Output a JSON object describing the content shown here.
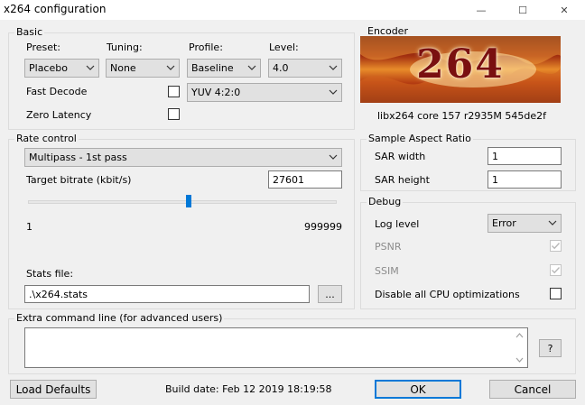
{
  "window": {
    "title": "x264 configuration",
    "minimize": "—",
    "maximize": "☐",
    "close": "✕"
  },
  "basic": {
    "group_label": "Basic",
    "preset_label": "Preset:",
    "preset_value": "Placebo",
    "tuning_label": "Tuning:",
    "tuning_value": "None",
    "profile_label": "Profile:",
    "profile_value": "Baseline",
    "level_label": "Level:",
    "level_value": "4.0",
    "colorspace_value": "YUV 4:2:0",
    "fast_decode_label": "Fast Decode",
    "fast_decode_checked": false,
    "zero_latency_label": "Zero Latency",
    "zero_latency_checked": false
  },
  "encoder": {
    "group_label": "Encoder",
    "logo_text": "264",
    "version": "libx264 core 157 r2935M 545de2f"
  },
  "rate_control": {
    "group_label": "Rate control",
    "mode_value": "Multipass - 1st pass",
    "bitrate_label": "Target bitrate (kbit/s)",
    "bitrate_value": "27601",
    "slider_min": "1",
    "slider_max": "999999",
    "slider_fraction": 0.52,
    "stats_label": "Stats file:",
    "stats_value": ".\\x264.stats",
    "browse_label": "..."
  },
  "sar": {
    "group_label": "Sample Aspect Ratio",
    "width_label": "SAR width",
    "width_value": "1",
    "height_label": "SAR height",
    "height_value": "1"
  },
  "debug": {
    "group_label": "Debug",
    "log_level_label": "Log level",
    "log_level_value": "Error",
    "psnr_label": "PSNR",
    "psnr_checked": true,
    "ssim_label": "SSIM",
    "ssim_checked": true,
    "cpu_opt_label": "Disable all CPU optimizations",
    "cpu_opt_checked": false
  },
  "extra": {
    "group_label": "Extra command line (for advanced users)",
    "value": "",
    "help_label": "?"
  },
  "footer": {
    "load_defaults_label": "Load Defaults",
    "build_date": "Build date: Feb 12 2019 18:19:58",
    "ok_label": "OK",
    "cancel_label": "Cancel"
  }
}
